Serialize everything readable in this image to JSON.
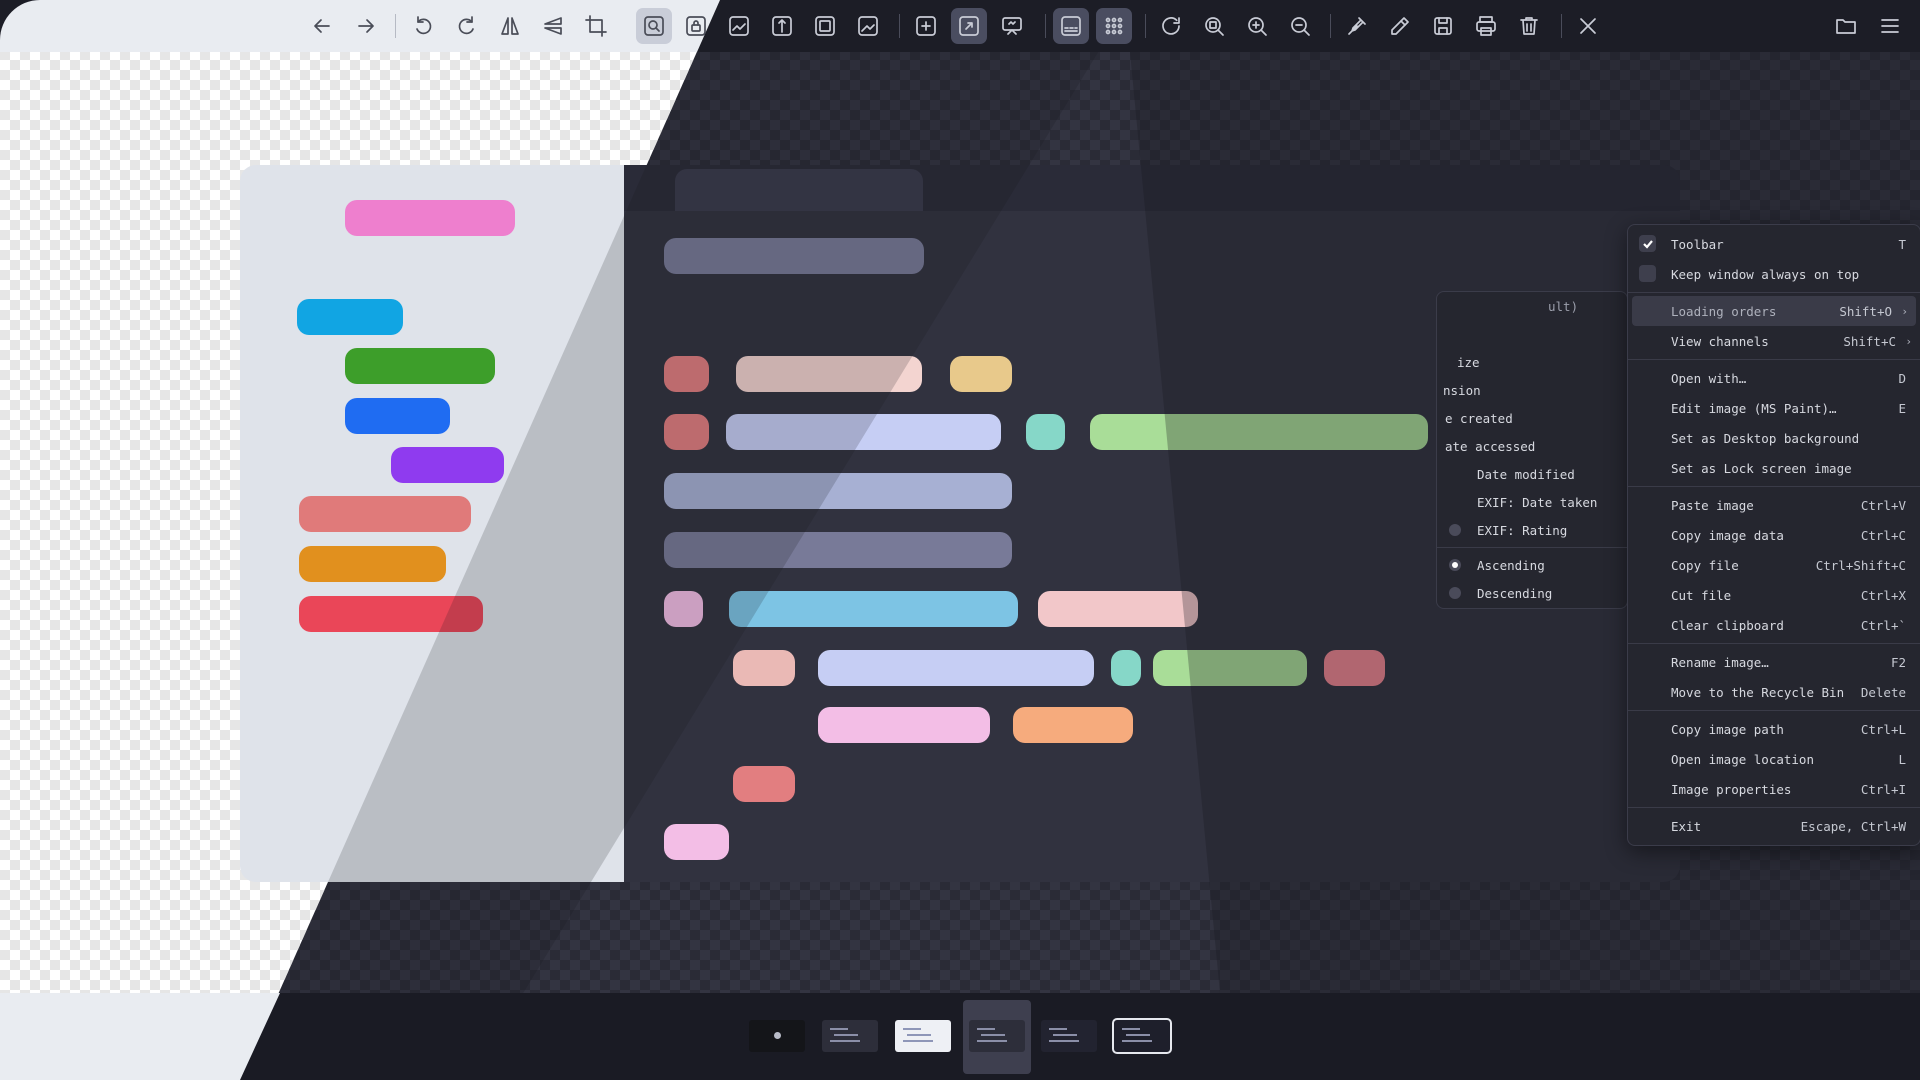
{
  "toolbar": {
    "left_group": [
      {
        "name": "back-icon"
      },
      {
        "name": "forward-icon"
      },
      {
        "name": "rotate-left-icon"
      },
      {
        "name": "rotate-right-icon"
      },
      {
        "name": "flip-horizontal-icon"
      },
      {
        "name": "flip-vertical-icon"
      },
      {
        "name": "crop-icon"
      }
    ],
    "view_group": [
      {
        "name": "auto-zoom-icon"
      },
      {
        "name": "lock-zoom-icon"
      },
      {
        "name": "scale-to-width-icon"
      },
      {
        "name": "scale-to-height-icon"
      },
      {
        "name": "scale-to-fit-icon"
      },
      {
        "name": "scale-to-fill-icon"
      }
    ],
    "mode_group": [
      {
        "name": "frameless-icon"
      },
      {
        "name": "full-screen-icon"
      },
      {
        "name": "slideshow-icon"
      }
    ],
    "gallery_group": [
      {
        "name": "thumbnail-bar-icon"
      },
      {
        "name": "gallery-icon"
      }
    ],
    "zoom_group": [
      {
        "name": "refresh-icon"
      },
      {
        "name": "actual-size-icon"
      },
      {
        "name": "zoom-in-icon"
      },
      {
        "name": "zoom-out-icon"
      }
    ],
    "edit_group": [
      {
        "name": "color-picker-icon"
      },
      {
        "name": "edit-icon"
      },
      {
        "name": "save-icon"
      },
      {
        "name": "print-icon"
      },
      {
        "name": "delete-icon"
      }
    ],
    "close": {
      "name": "close-icon"
    },
    "right_group": [
      {
        "name": "open-folder-icon"
      },
      {
        "name": "main-menu-icon"
      }
    ]
  },
  "context_menu": {
    "items": [
      {
        "label": "Toolbar",
        "shortcut": "T",
        "checkbox": true,
        "checked": true
      },
      {
        "label": "Keep window always on top",
        "shortcut": "",
        "checkbox": true,
        "checked": false
      },
      {
        "separator": true
      },
      {
        "label": "Loading orders",
        "shortcut": "Shift+O",
        "submenu": true,
        "highlighted": true
      },
      {
        "label": "View channels",
        "shortcut": "Shift+C",
        "submenu": true
      },
      {
        "separator": true
      },
      {
        "label": "Open with…",
        "shortcut": "D"
      },
      {
        "label": "Edit image (MS Paint)…",
        "shortcut": "E"
      },
      {
        "label": "Set as Desktop background",
        "shortcut": ""
      },
      {
        "label": "Set as Lock screen image",
        "shortcut": ""
      },
      {
        "separator": true
      },
      {
        "label": "Paste image",
        "shortcut": "Ctrl+V"
      },
      {
        "label": "Copy image data",
        "shortcut": "Ctrl+C"
      },
      {
        "label": "Copy file",
        "shortcut": "Ctrl+Shift+C"
      },
      {
        "label": "Cut file",
        "shortcut": "Ctrl+X"
      },
      {
        "label": "Clear clipboard",
        "shortcut": "Ctrl+`"
      },
      {
        "separator": true
      },
      {
        "label": "Rename image…",
        "shortcut": "F2"
      },
      {
        "label": "Move to the Recycle Bin",
        "shortcut": "Delete"
      },
      {
        "separator": true
      },
      {
        "label": "Copy image path",
        "shortcut": "Ctrl+L"
      },
      {
        "label": "Open image location",
        "shortcut": "L"
      },
      {
        "label": "Image properties",
        "shortcut": "Ctrl+I"
      },
      {
        "separator": true
      },
      {
        "label": "Exit",
        "shortcut": "Escape, Ctrl+W"
      }
    ]
  },
  "loading_orders_submenu": {
    "partial_top": "ult)",
    "items": [
      {
        "label": "ize"
      },
      {
        "label": "nsion"
      },
      {
        "label": "e created"
      },
      {
        "label": "ate accessed"
      },
      {
        "label": "Date modified"
      },
      {
        "label": "EXIF: Date taken"
      },
      {
        "label": "EXIF: Rating",
        "radio": true
      },
      {
        "label": "Ascending",
        "radio": true,
        "selected": true
      },
      {
        "label": "Descending",
        "radio": true,
        "selected": false
      }
    ]
  },
  "thumbnails": [
    {
      "name": "thumbnail-1",
      "selected": false
    },
    {
      "name": "thumbnail-2",
      "selected": false
    },
    {
      "name": "thumbnail-3",
      "selected": false
    },
    {
      "name": "thumbnail-4",
      "selected": true
    },
    {
      "name": "thumbnail-5",
      "selected": false
    },
    {
      "name": "thumbnail-6",
      "selected": false
    }
  ],
  "colors": {
    "accent_pink": "#ee7fce",
    "accent_cyan": "#11a5e3",
    "accent_green": "#3d9e2a",
    "accent_blue": "#1f6cf2",
    "accent_purple": "#8f3bef",
    "accent_salmon": "#e07a7a",
    "accent_orange": "#e1901e",
    "accent_red": "#ea4658"
  }
}
